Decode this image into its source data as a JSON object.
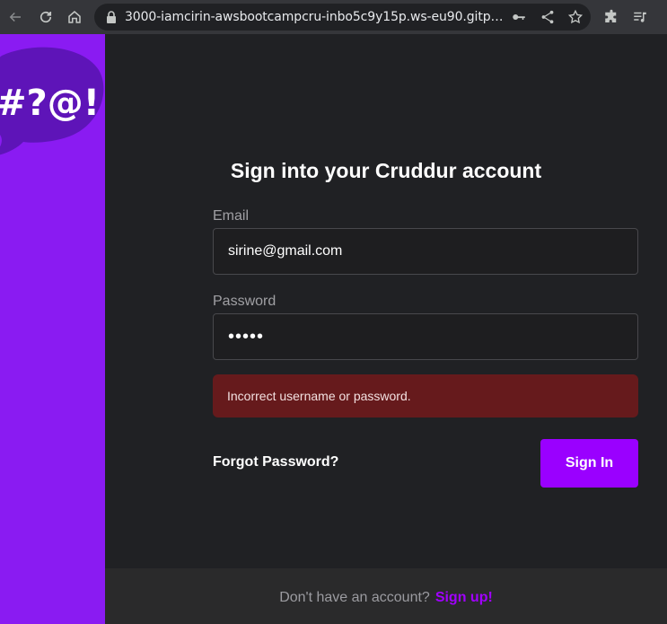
{
  "browser": {
    "url": "3000-iamcirin-awsbootcampcru-inbo5c9y15p.ws-eu90.gitpod.io/…",
    "icons": [
      "back-icon",
      "reload-icon",
      "home-icon",
      "lock-icon",
      "key-icon",
      "share-icon",
      "star-icon",
      "extensions-icon",
      "media-icon"
    ]
  },
  "brand": {
    "logo_text": "#?@!",
    "colors": {
      "sidebar": "#8a1bf2",
      "accent": "#9a00ff",
      "error_bg": "#661a1c"
    }
  },
  "signin": {
    "title": "Sign into your Cruddur account",
    "email_label": "Email",
    "email_value": "sirine@gmail.com",
    "password_label": "Password",
    "password_value": "•••••",
    "error_message": "Incorrect username or password.",
    "forgot_label": "Forgot Password?",
    "submit_label": "Sign In"
  },
  "footer": {
    "prompt": "Don't have an account?",
    "signup_label": "Sign up!"
  }
}
